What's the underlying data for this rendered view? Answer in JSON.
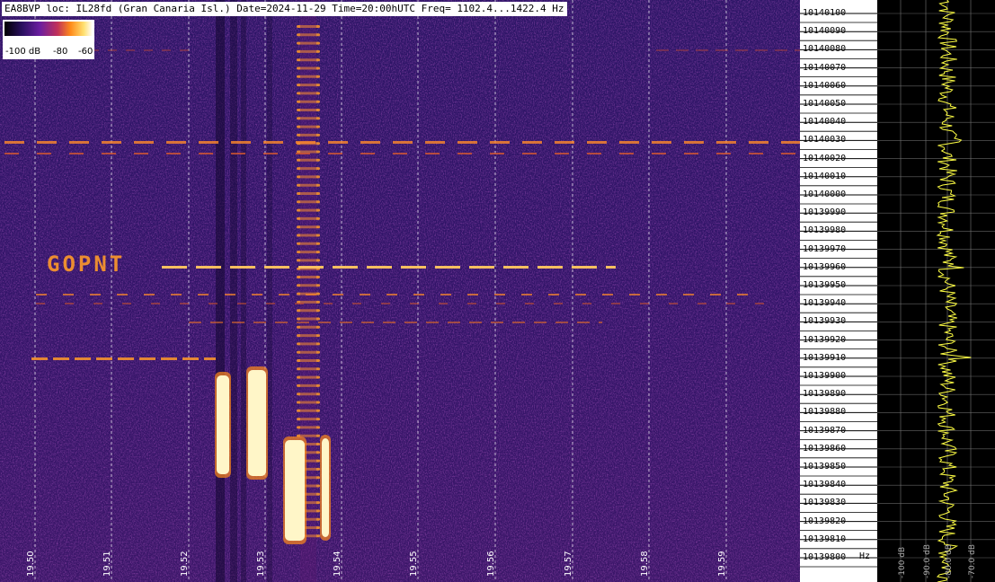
{
  "header": {
    "text": "EA8BVP loc: IL28fd (Gran Canaria Isl.) Date=2024-11-29 Time=20:00hUTC Freq= 1102.4...1422.4 Hz"
  },
  "color_scale": {
    "labels": [
      "-100 dB",
      "-80",
      "-60"
    ],
    "colors": [
      "#000000",
      "#2a1060",
      "#6a1ea0",
      "#c0305a",
      "#ff8a1a",
      "#ffe070",
      "#ffffff"
    ]
  },
  "time_axis": {
    "labels": [
      "19.50",
      "19.51",
      "19.52",
      "19.53",
      "19.54",
      "19.55",
      "19.56",
      "19.57",
      "19.58",
      "19.59"
    ]
  },
  "freq_axis": {
    "labels": [
      "10140100",
      "10140090",
      "10140080",
      "10140070",
      "10140060",
      "10140050",
      "10140040",
      "10140030",
      "10140020",
      "10140010",
      "10140000",
      "10139990",
      "10139980",
      "10139970",
      "10139960",
      "10139950",
      "10139940",
      "10139930",
      "10139920",
      "10139910",
      "10139900",
      "10139890",
      "10139880",
      "10139870",
      "10139860",
      "10139850",
      "10139840",
      "10139830",
      "10139820",
      "10139810",
      "10139800"
    ],
    "unit": "Hz"
  },
  "spectrum_axis": {
    "labels": [
      "-100 dB",
      "-90.0 dB",
      "-80.0 dB",
      "-70.0 dB"
    ]
  },
  "signals": {
    "callsign_trace": "GOPNT"
  },
  "colors": {
    "background": "#2a1260",
    "trace": "#ffff44",
    "grid": "#ffffff"
  }
}
